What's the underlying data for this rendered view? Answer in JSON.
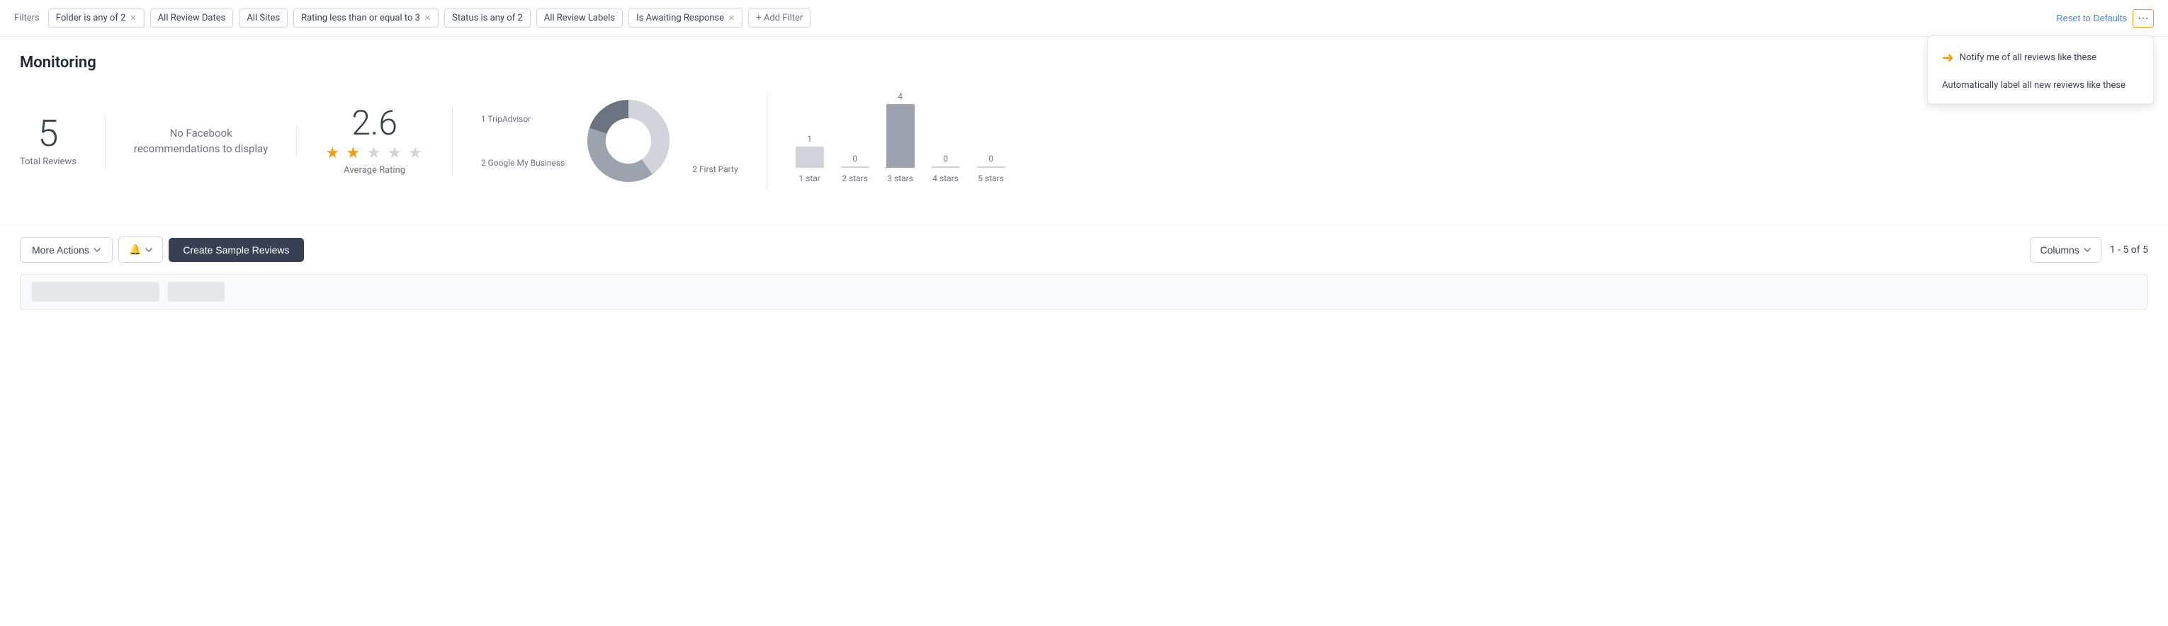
{
  "filterBar": {
    "label": "Filters",
    "chips": [
      {
        "id": "folder",
        "text": "Folder is any of 2",
        "hasClose": true
      },
      {
        "id": "dates",
        "text": "All Review Dates",
        "hasClose": false
      },
      {
        "id": "sites",
        "text": "All Sites",
        "hasClose": false
      },
      {
        "id": "rating",
        "text": "Rating less than or equal to 3",
        "hasClose": true
      },
      {
        "id": "status",
        "text": "Status is any of 2",
        "hasClose": false
      },
      {
        "id": "labels",
        "text": "All Review Labels",
        "hasClose": false
      },
      {
        "id": "awaiting",
        "text": "Is Awaiting Response",
        "hasClose": true
      }
    ],
    "addFilter": "+ Add Filter",
    "resetDefaults": "Reset to Defaults",
    "moreLabel": "···"
  },
  "dropdown": {
    "items": [
      {
        "id": "notify",
        "text": "Notify me of all reviews like these",
        "hasArrow": true
      },
      {
        "id": "label",
        "text": "Automatically label all new reviews like these",
        "hasArrow": false
      }
    ]
  },
  "page": {
    "title": "Monitoring"
  },
  "stats": {
    "totalReviews": {
      "number": "5",
      "label": "Total Reviews"
    },
    "facebook": {
      "line1": "No Facebook",
      "line2": "recommendations to display"
    },
    "rating": {
      "number": "2.6",
      "label": "Average Rating",
      "filledStars": 2,
      "totalStars": 5
    },
    "donut": {
      "segments": [
        {
          "label": "1 TripAdvisor",
          "value": 1,
          "color": "#6b7280"
        },
        {
          "label": "2 Google My Business",
          "value": 2,
          "color": "#9ca3af"
        },
        {
          "label": "2 First Party",
          "value": 2,
          "color": "#d1d5db"
        }
      ],
      "total": 5
    },
    "bars": [
      {
        "label": "1 star",
        "value": 1,
        "height": 30
      },
      {
        "label": "2 stars",
        "value": 0,
        "height": 0
      },
      {
        "label": "3 stars",
        "value": 4,
        "height": 90
      },
      {
        "label": "4 stars",
        "value": 0,
        "height": 0
      },
      {
        "label": "5 stars",
        "value": 0,
        "height": 0
      }
    ]
  },
  "actions": {
    "moreActions": "More Actions",
    "bellLabel": "",
    "createSample": "Create Sample Reviews",
    "columnsLabel": "Columns",
    "pagination": "1 - 5 of 5"
  }
}
